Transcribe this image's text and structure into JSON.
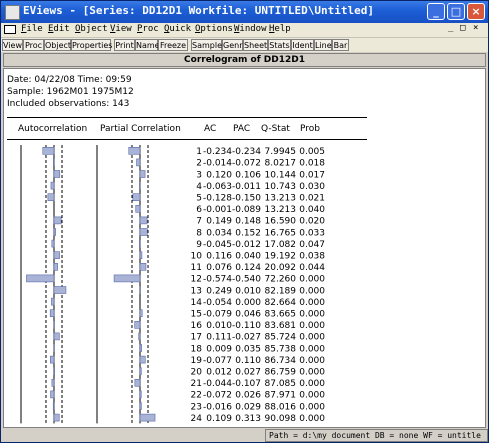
{
  "window": {
    "title": "EViews - [Series: DD12D1    Workfile: UNTITLED\\Untitled]",
    "controls": {
      "minimize": "_",
      "maximize": "□",
      "close": "×"
    }
  },
  "menu": [
    "File",
    "Edit",
    "Object",
    "View",
    "Proc",
    "Quick",
    "Options",
    "Window",
    "Help"
  ],
  "mdi_controls": {
    "minimize": "_",
    "restore": "□",
    "close": "×"
  },
  "toolbar": [
    "View",
    "Proc",
    "Object",
    "Properties",
    "Print",
    "Name",
    "Freeze",
    "Sample",
    "Genr",
    "Sheet",
    "Stats",
    "Ident",
    "Line",
    "Bar"
  ],
  "header": "Correlogram of DD12D1",
  "info": {
    "date": "Date: 04/22/08   Time: 09:59",
    "sample": "Sample: 1962M01 1975M12",
    "obs": "Included observations: 143"
  },
  "columns": {
    "autocorrelation": "Autocorrelation",
    "partial": "Partial Correlation",
    "ac": "AC",
    "pac": "PAC",
    "qstat": "Q-Stat",
    "prob": "Prob"
  },
  "status": {
    "path": "Path = d:\\my document  DB = none  WF = untitle"
  },
  "chart_data": {
    "type": "table",
    "rows": [
      {
        "lag": 1,
        "ac": -0.234,
        "pac": -0.234,
        "q": 7.9945,
        "prob": 0.005
      },
      {
        "lag": 2,
        "ac": -0.014,
        "pac": -0.072,
        "q": 8.0217,
        "prob": 0.018
      },
      {
        "lag": 3,
        "ac": 0.12,
        "pac": 0.106,
        "q": 10.144,
        "prob": 0.017
      },
      {
        "lag": 4,
        "ac": -0.063,
        "pac": -0.011,
        "q": 10.743,
        "prob": 0.03
      },
      {
        "lag": 5,
        "ac": -0.128,
        "pac": -0.15,
        "q": 13.213,
        "prob": 0.021
      },
      {
        "lag": 6,
        "ac": -0.001,
        "pac": -0.089,
        "q": 13.213,
        "prob": 0.04
      },
      {
        "lag": 7,
        "ac": 0.149,
        "pac": 0.148,
        "q": 16.59,
        "prob": 0.02
      },
      {
        "lag": 8,
        "ac": 0.034,
        "pac": 0.152,
        "q": 16.765,
        "prob": 0.033
      },
      {
        "lag": 9,
        "ac": -0.045,
        "pac": -0.012,
        "q": 17.082,
        "prob": 0.047
      },
      {
        "lag": 10,
        "ac": 0.116,
        "pac": 0.04,
        "q": 19.192,
        "prob": 0.038
      },
      {
        "lag": 11,
        "ac": 0.076,
        "pac": 0.124,
        "q": 20.092,
        "prob": 0.044
      },
      {
        "lag": 12,
        "ac": -0.574,
        "pac": -0.54,
        "q": 72.26,
        "prob": 0.0
      },
      {
        "lag": 13,
        "ac": 0.249,
        "pac": 0.01,
        "q": 82.189,
        "prob": 0.0
      },
      {
        "lag": 14,
        "ac": -0.054,
        "pac": 0.0,
        "q": 82.664,
        "prob": 0.0
      },
      {
        "lag": 15,
        "ac": -0.079,
        "pac": 0.046,
        "q": 83.665,
        "prob": 0.0
      },
      {
        "lag": 16,
        "ac": 0.01,
        "pac": -0.11,
        "q": 83.681,
        "prob": 0.0
      },
      {
        "lag": 17,
        "ac": 0.111,
        "pac": -0.027,
        "q": 85.724,
        "prob": 0.0
      },
      {
        "lag": 18,
        "ac": 0.009,
        "pac": 0.035,
        "q": 85.738,
        "prob": 0.0
      },
      {
        "lag": 19,
        "ac": -0.077,
        "pac": 0.11,
        "q": 86.734,
        "prob": 0.0
      },
      {
        "lag": 20,
        "ac": 0.012,
        "pac": 0.027,
        "q": 86.759,
        "prob": 0.0
      },
      {
        "lag": 21,
        "ac": -0.044,
        "pac": -0.107,
        "q": 87.085,
        "prob": 0.0
      },
      {
        "lag": 22,
        "ac": -0.072,
        "pac": 0.026,
        "q": 87.971,
        "prob": 0.0
      },
      {
        "lag": 23,
        "ac": -0.016,
        "pac": 0.029,
        "q": 88.016,
        "prob": 0.0
      },
      {
        "lag": 24,
        "ac": 0.109,
        "pac": 0.313,
        "q": 90.098,
        "prob": 0.0
      }
    ],
    "bar_color": "#a9b3d6",
    "bar_border": "#5a6aa8"
  }
}
